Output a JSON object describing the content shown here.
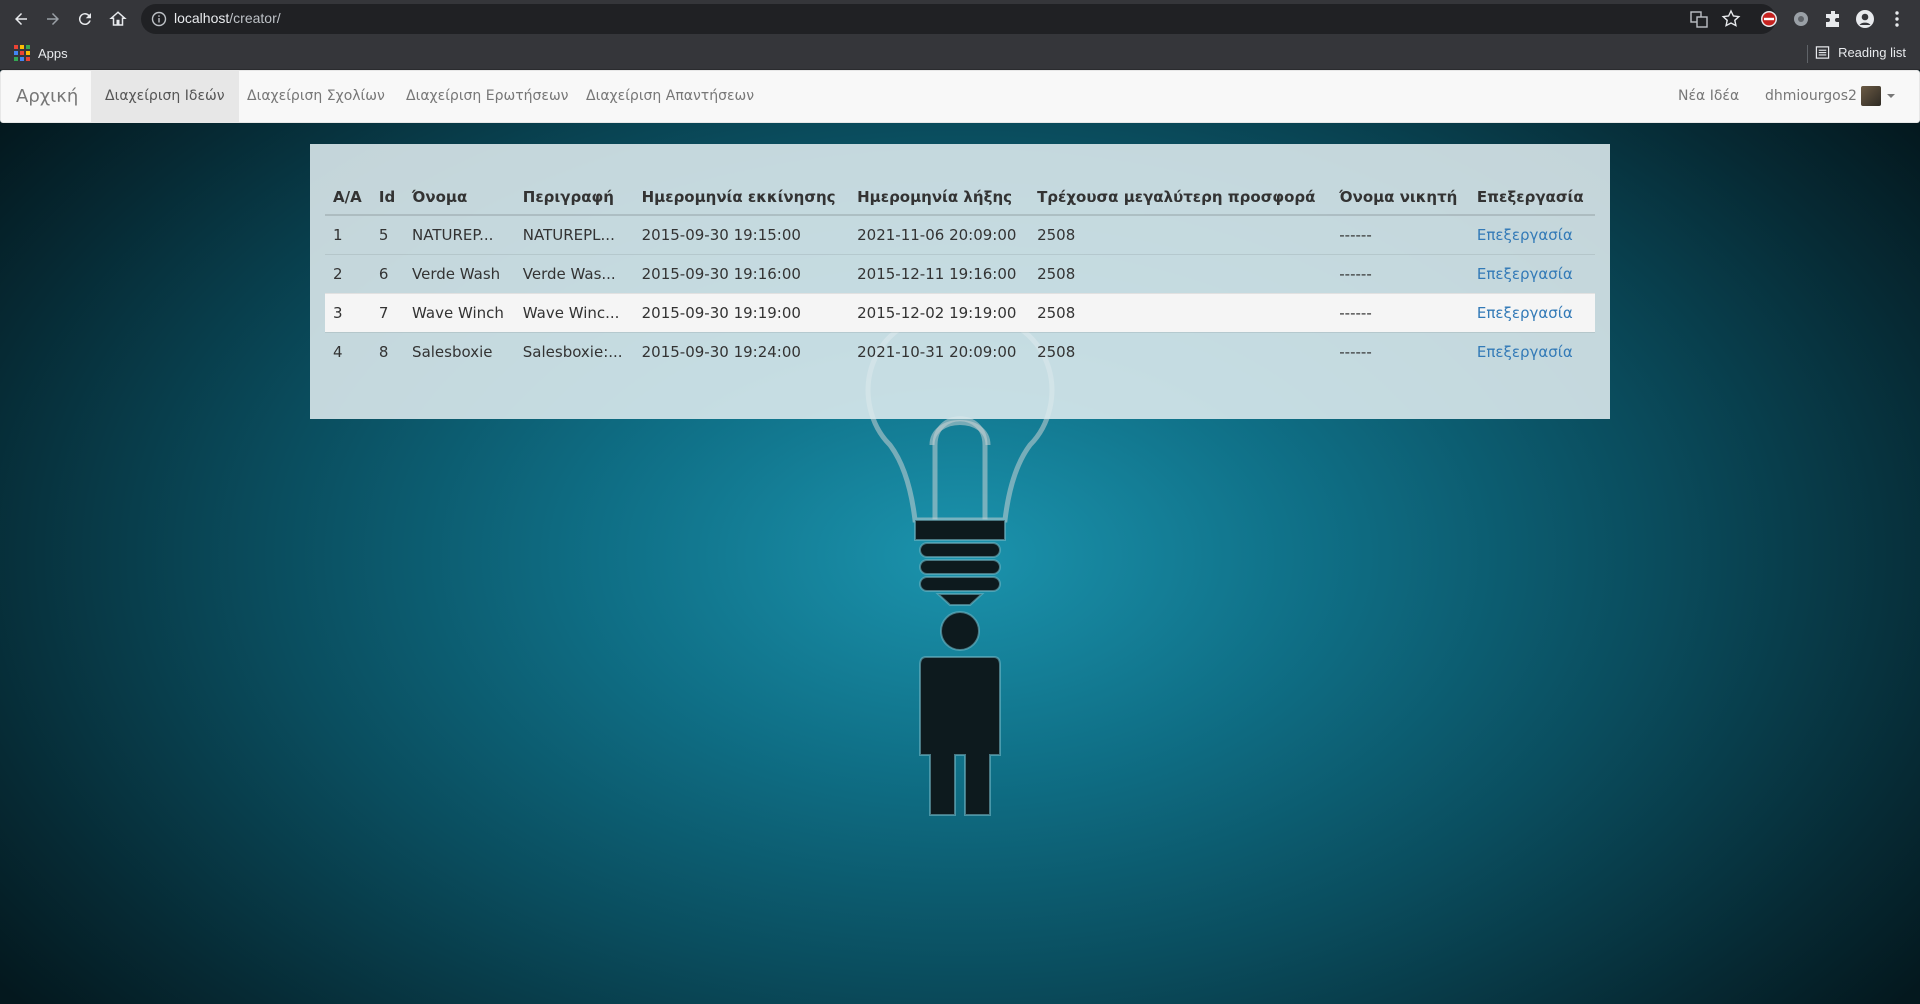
{
  "browser": {
    "url_host": "localhost",
    "url_path": "/creator/",
    "bookmarks": {
      "apps_label": "Apps",
      "reading_list_label": "Reading list"
    },
    "icons": [
      "back-icon",
      "forward-icon",
      "reload-icon",
      "home-icon",
      "info-icon",
      "translate-icon",
      "star-icon",
      "extensions-icon",
      "profile-icon",
      "menu-icon"
    ]
  },
  "navbar": {
    "brand": "Αρχική",
    "items": [
      {
        "label": "Διαχείριση Ιδεών",
        "active": true
      },
      {
        "label": "Διαχείριση Σχολίων",
        "active": false
      },
      {
        "label": "Διαχείριση Ερωτήσεων",
        "active": false
      },
      {
        "label": "Διαχείριση Απαντήσεων",
        "active": false
      }
    ],
    "new_idea": "Νέα Ιδέα",
    "username": "dhmiourgos2"
  },
  "table": {
    "headers": [
      "A/A",
      "Id",
      "Όνομα",
      "Περιγραφή",
      "Ημερομηνία εκκίνησης",
      "Ημερομηνία λήξης",
      "Τρέχουσα μεγαλύτερη προσφορά",
      "Όνομα νικητή",
      "Επεξεργασία"
    ],
    "rows": [
      [
        "1",
        "5",
        "NATUREP...",
        "NATUREPL...",
        "2015-09-30 19:15:00",
        "2021-11-06 20:09:00",
        "2508",
        "------",
        "Επεξεργασία"
      ],
      [
        "2",
        "6",
        "Verde Wash",
        "Verde Was...",
        "2015-09-30 19:16:00",
        "2015-12-11 19:16:00",
        "2508",
        "------",
        "Επεξεργασία"
      ],
      [
        "3",
        "7",
        "Wave Winch",
        "Wave Winc...",
        "2015-09-30 19:19:00",
        "2015-12-02 19:19:00",
        "2508",
        "------",
        "Επεξεργασία"
      ],
      [
        "4",
        "8",
        "Salesboxie",
        "Salesboxie:...",
        "2015-09-30 19:24:00",
        "2021-10-31 20:09:00",
        "2508",
        "------",
        "Επεξεργασία"
      ]
    ],
    "highlighted_row": 3
  },
  "colors": {
    "link": "#337ab7",
    "navbar_bg": "#f8f8f8",
    "page_accent": "#1b93ad"
  }
}
